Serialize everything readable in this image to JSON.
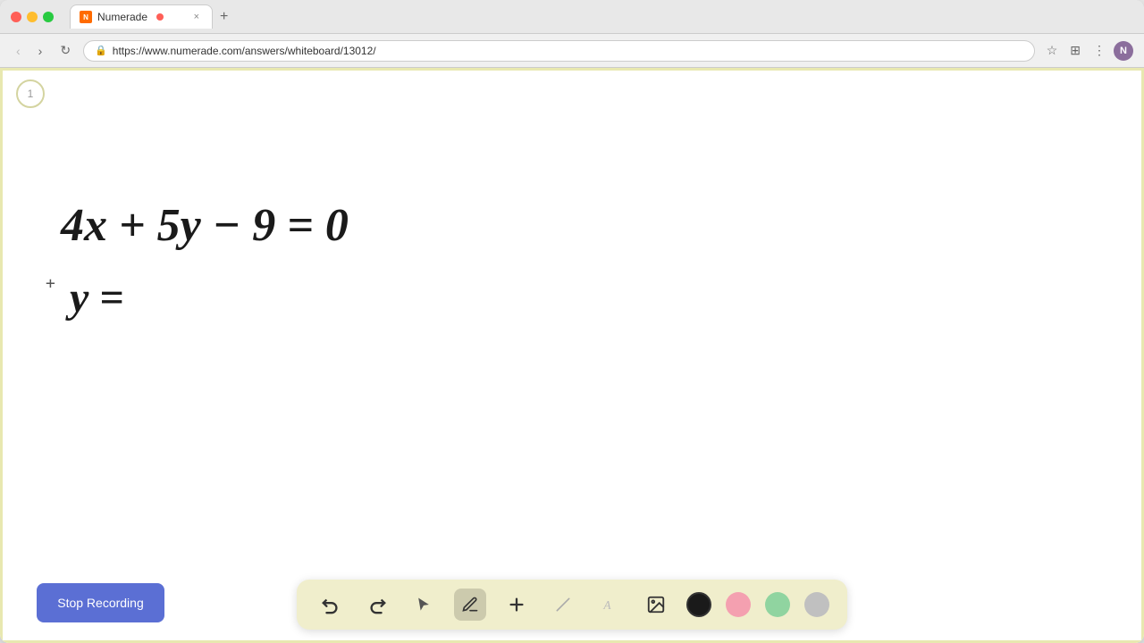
{
  "browser": {
    "tab": {
      "favicon_label": "N",
      "title": "Numerade",
      "recording_dot": true,
      "close": "×"
    },
    "new_tab": "+",
    "address": "https://www.numerade.com/answers/whiteboard/13012/",
    "nav": {
      "back": "‹",
      "forward": "›",
      "refresh": "↻"
    }
  },
  "page": {
    "number": "1"
  },
  "toolbar": {
    "stop_recording_label": "Stop Recording",
    "tools": [
      {
        "name": "undo",
        "icon": "↩",
        "label": "Undo"
      },
      {
        "name": "redo",
        "icon": "↪",
        "label": "Redo"
      },
      {
        "name": "select",
        "icon": "↖",
        "label": "Select"
      },
      {
        "name": "pen",
        "icon": "✏",
        "label": "Pen"
      },
      {
        "name": "add",
        "icon": "+",
        "label": "Add"
      },
      {
        "name": "eraser",
        "icon": "╱",
        "label": "Eraser"
      },
      {
        "name": "text",
        "icon": "A",
        "label": "Text"
      },
      {
        "name": "image",
        "icon": "🖼",
        "label": "Image"
      }
    ],
    "colors": [
      {
        "name": "black",
        "value": "#1a1a1a",
        "selected": true
      },
      {
        "name": "pink",
        "value": "#f4a0b0",
        "selected": false
      },
      {
        "name": "green",
        "value": "#90d4a0",
        "selected": false
      },
      {
        "name": "gray",
        "value": "#c0c0c0",
        "selected": false
      }
    ]
  },
  "whiteboard": {
    "equation1": "4x + 5y − 9 = 0",
    "equation2": "y ="
  }
}
